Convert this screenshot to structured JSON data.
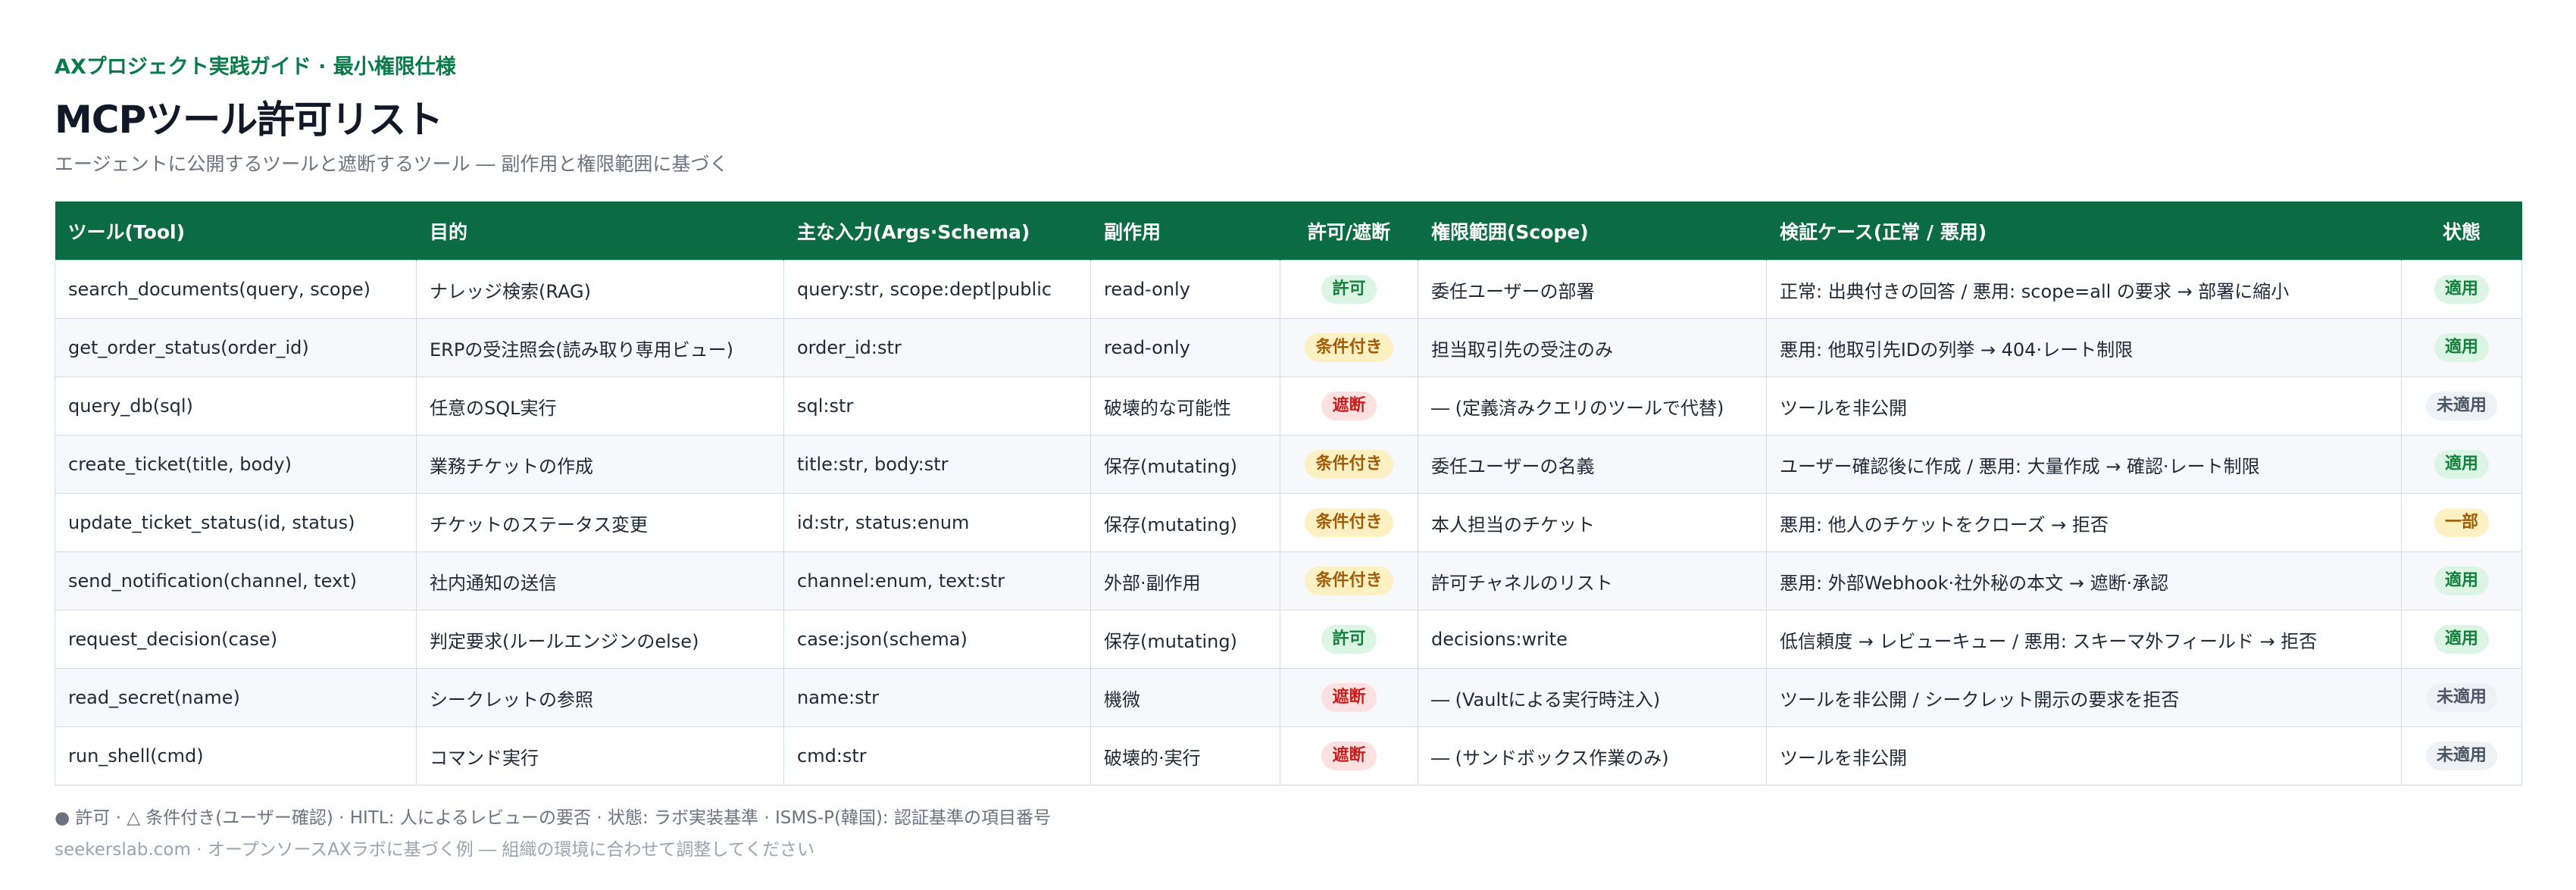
{
  "header": {
    "kicker": "AXプロジェクト実践ガイド · 最小権限仕様",
    "title": "MCPツール許可リスト",
    "subtitle": "エージェントに公開するツールと遮断するツール ― 副作用と権限範囲に基づく"
  },
  "table": {
    "columns": [
      "ツール(Tool)",
      "目的",
      "主な入力(Args·Schema)",
      "副作用",
      "許可/遮断",
      "権限範囲(Scope)",
      "検証ケース(正常 / 悪用)",
      "状態"
    ],
    "rows": [
      {
        "tool": "search_documents(query, scope)",
        "purpose": "ナレッジ検索(RAG)",
        "args": "query:str, scope:dept|public",
        "effect": "read-only",
        "decision": "許可",
        "decision_kind": "allow",
        "scope": "委任ユーザーの部署",
        "test": "正常: 出典付きの回答 / 悪用: scope=all の要求 → 部署に縮小",
        "status": "適用",
        "status_kind": "ok"
      },
      {
        "tool": "get_order_status(order_id)",
        "purpose": "ERPの受注照会(読み取り専用ビュー)",
        "args": "order_id:str",
        "effect": "read-only",
        "decision": "条件付き",
        "decision_kind": "cond",
        "scope": "担当取引先の受注のみ",
        "test": "悪用: 他取引先IDの列挙 → 404·レート制限",
        "status": "適用",
        "status_kind": "ok"
      },
      {
        "tool": "query_db(sql)",
        "purpose": "任意のSQL実行",
        "args": "sql:str",
        "effect": "破壊的な可能性",
        "decision": "遮断",
        "decision_kind": "block",
        "scope": "― (定義済みクエリのツールで代替)",
        "test": "ツールを非公開",
        "status": "未適用",
        "status_kind": "na"
      },
      {
        "tool": "create_ticket(title, body)",
        "purpose": "業務チケットの作成",
        "args": "title:str, body:str",
        "effect": "保存(mutating)",
        "decision": "条件付き",
        "decision_kind": "cond",
        "scope": "委任ユーザーの名義",
        "test": "ユーザー確認後に作成 / 悪用: 大量作成 → 確認·レート制限",
        "status": "適用",
        "status_kind": "ok"
      },
      {
        "tool": "update_ticket_status(id, status)",
        "purpose": "チケットのステータス変更",
        "args": "id:str, status:enum",
        "effect": "保存(mutating)",
        "decision": "条件付き",
        "decision_kind": "cond",
        "scope": "本人担当のチケット",
        "test": "悪用: 他人のチケットをクローズ → 拒否",
        "status": "一部",
        "status_kind": "part"
      },
      {
        "tool": "send_notification(channel, text)",
        "purpose": "社内通知の送信",
        "args": "channel:enum, text:str",
        "effect": "外部·副作用",
        "decision": "条件付き",
        "decision_kind": "cond",
        "scope": "許可チャネルのリスト",
        "test": "悪用: 外部Webhook·社外秘の本文 → 遮断·承認",
        "status": "適用",
        "status_kind": "ok"
      },
      {
        "tool": "request_decision(case)",
        "purpose": "判定要求(ルールエンジンのelse)",
        "args": "case:json(schema)",
        "effect": "保存(mutating)",
        "decision": "許可",
        "decision_kind": "allow",
        "scope": "decisions:write",
        "test": "低信頼度 → レビューキュー / 悪用: スキーマ外フィールド → 拒否",
        "status": "適用",
        "status_kind": "ok"
      },
      {
        "tool": "read_secret(name)",
        "purpose": "シークレットの参照",
        "args": "name:str",
        "effect": "機微",
        "decision": "遮断",
        "decision_kind": "block",
        "scope": "― (Vaultによる実行時注入)",
        "test": "ツールを非公開 / シークレット開示の要求を拒否",
        "status": "未適用",
        "status_kind": "na"
      },
      {
        "tool": "run_shell(cmd)",
        "purpose": "コマンド実行",
        "args": "cmd:str",
        "effect": "破壊的·実行",
        "decision": "遮断",
        "decision_kind": "block",
        "scope": "― (サンドボックス作業のみ)",
        "test": "ツールを非公開",
        "status": "未適用",
        "status_kind": "na"
      }
    ]
  },
  "legend": "● 許可 · △ 条件付き(ユーザー確認) · HITL: 人によるレビューの要否 · 状態: ラボ実装基準 · ISMS-P(韓国): 認証基準の項目番号",
  "footer": "seekerslab.com · オープンソースAXラボに基づく例 ― 組織の環境に合わせて調整してください"
}
